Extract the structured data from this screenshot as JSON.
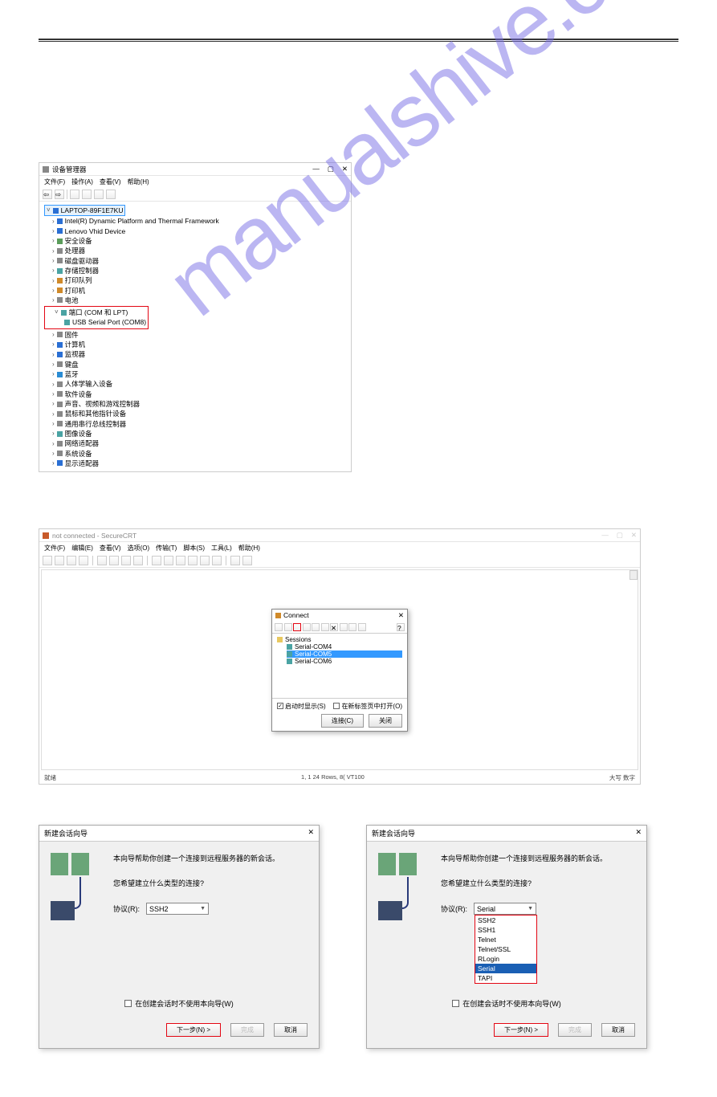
{
  "watermark": "manualshive.com",
  "device_manager": {
    "title": "设备管理器",
    "menus": [
      "文件(F)",
      "操作(A)",
      "查看(V)",
      "帮助(H)"
    ],
    "root": "LAPTOP-89F1E7KU",
    "nodes": {
      "intel_platform": "Intel(R) Dynamic Platform and Thermal Framework",
      "lenovo_vhid": "Lenovo Vhid Device",
      "security": "安全设备",
      "processors": "处理器",
      "disk": "磁盘驱动器",
      "storage_ctrl": "存储控制器",
      "print_queue": "打印队列",
      "printers": "打印机",
      "batteries": "电池",
      "ports": "端口 (COM 和 LPT)",
      "usb_serial": "USB Serial Port (COM8)",
      "firmware": "固件",
      "computer": "计算机",
      "monitors": "监视器",
      "keyboards": "键盘",
      "bluetooth": "蓝牙",
      "hid": "人体学输入设备",
      "software": "软件设备",
      "sound": "声音、视频和游戏控制器",
      "mouse": "鼠标和其他指针设备",
      "usb_ctrl": "通用串行总线控制器",
      "imaging": "图像设备",
      "network": "网络适配器",
      "system": "系统设备",
      "display": "显示适配器"
    }
  },
  "securecrt": {
    "title": "not connected - SecureCRT",
    "menus": [
      "文件(F)",
      "编辑(E)",
      "查看(V)",
      "选项(O)",
      "传输(T)",
      "脚本(S)",
      "工具(L)",
      "帮助(H)"
    ],
    "status_left": "就绪",
    "status_center": "1,  1    24 Rows,  8(  VT100",
    "status_right": "大写 数字",
    "connect": {
      "title": "Connect",
      "sessions_label": "Sessions",
      "items": [
        "Serial-COM4",
        "Serial-COM5",
        "Serial-COM6"
      ],
      "chk_startup": "启动时显示(S)",
      "chk_tab": "在新标签页中打开(O)",
      "btn_connect": "连接(C)",
      "btn_close": "关闭"
    }
  },
  "wizard": {
    "title": "新建会话向导",
    "intro": "本向导帮助你创建一个连接到远程服务器的新会话。",
    "question": "您希望建立什么类型的连接?",
    "proto_label": "协议(R):",
    "proto_value": "SSH2",
    "chk_skip": "在创建会话时不使用本向导(W)",
    "btn_next": "下一步(N) >",
    "btn_finish": "完成",
    "btn_cancel": "取消",
    "dropdown": {
      "selected_top": "Serial",
      "options": [
        "SSH2",
        "SSH1",
        "Telnet",
        "Telnet/SSL",
        "RLogin",
        "Serial",
        "TAPI"
      ]
    }
  }
}
